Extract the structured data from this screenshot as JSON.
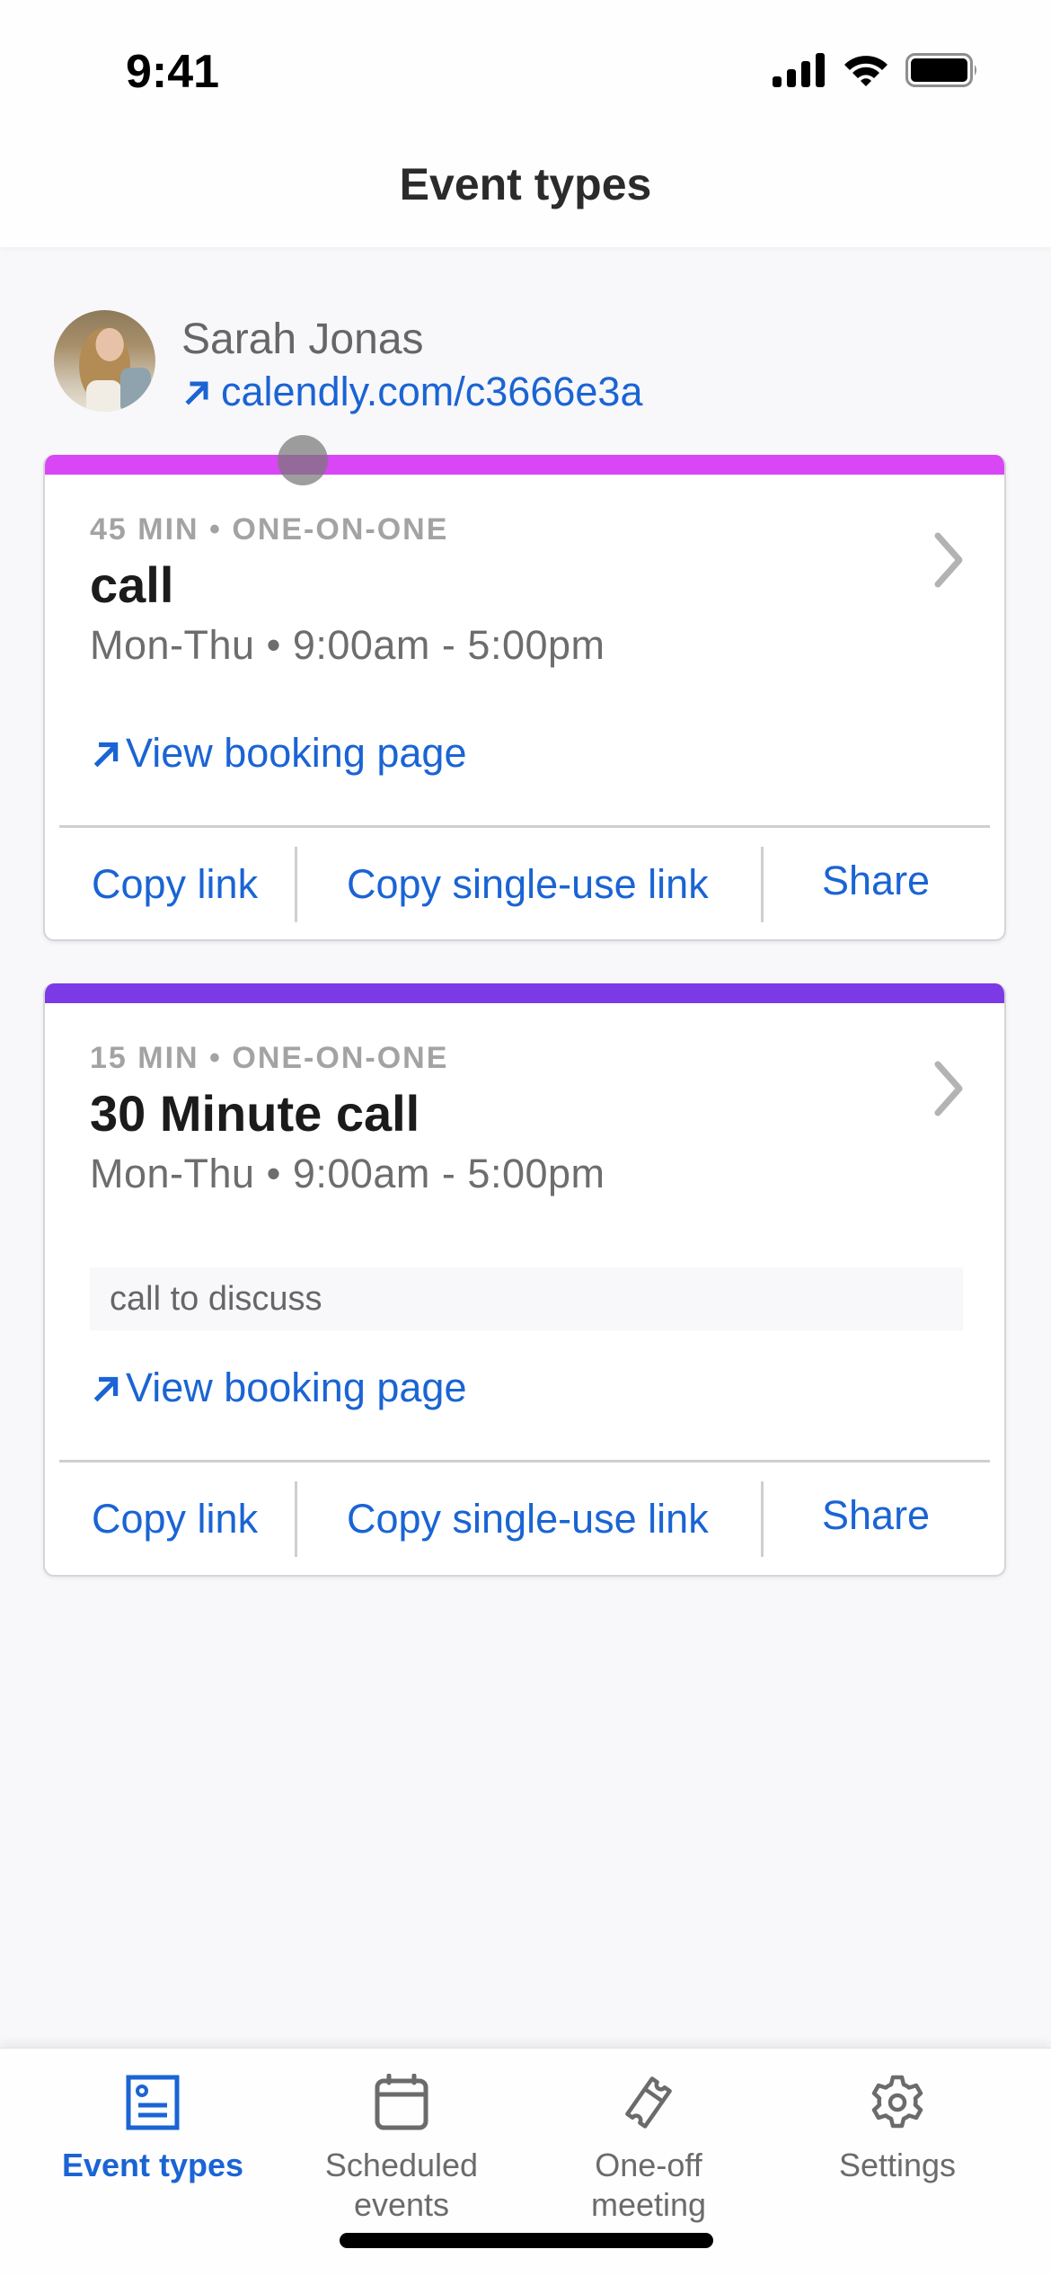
{
  "status_bar": {
    "time": "9:41",
    "icons": [
      "cellular-signal-icon",
      "wifi-icon",
      "battery-icon"
    ]
  },
  "header": {
    "title": "Event types"
  },
  "profile": {
    "name": "Sarah Jonas",
    "link_icon": "arrow-up-right-icon",
    "link": "calendly.com/c3666e3a"
  },
  "colors": {
    "accent_blue": "#1a64d4",
    "card1_bar": "#d946f5",
    "card2_bar": "#7b3ae6",
    "muted_text": "#6d6d6d"
  },
  "event_types": [
    {
      "meta": "45 MIN • ONE-ON-ONE",
      "title": "call",
      "hours": "Mon-Thu • 9:00am - 5:00pm",
      "description": null,
      "view_booking_label": "View booking page",
      "actions": {
        "copy_link": "Copy link",
        "copy_single_use": "Copy single-use link",
        "share": "Share"
      }
    },
    {
      "meta": "15 MIN • ONE-ON-ONE",
      "title": "30 Minute call",
      "hours": "Mon-Thu • 9:00am - 5:00pm",
      "description": "call to discuss",
      "view_booking_label": "View booking page",
      "actions": {
        "copy_link": "Copy link",
        "copy_single_use": "Copy single-use link",
        "share": "Share"
      }
    }
  ],
  "tabbar": {
    "active": "Event types",
    "items": [
      {
        "label": "Event types",
        "icon": "event-types-icon"
      },
      {
        "label": "Scheduled\nevents",
        "icon": "calendar-icon"
      },
      {
        "label": "One-off\nmeeting",
        "icon": "ticket-icon"
      },
      {
        "label": "Settings",
        "icon": "gear-icon"
      }
    ]
  }
}
